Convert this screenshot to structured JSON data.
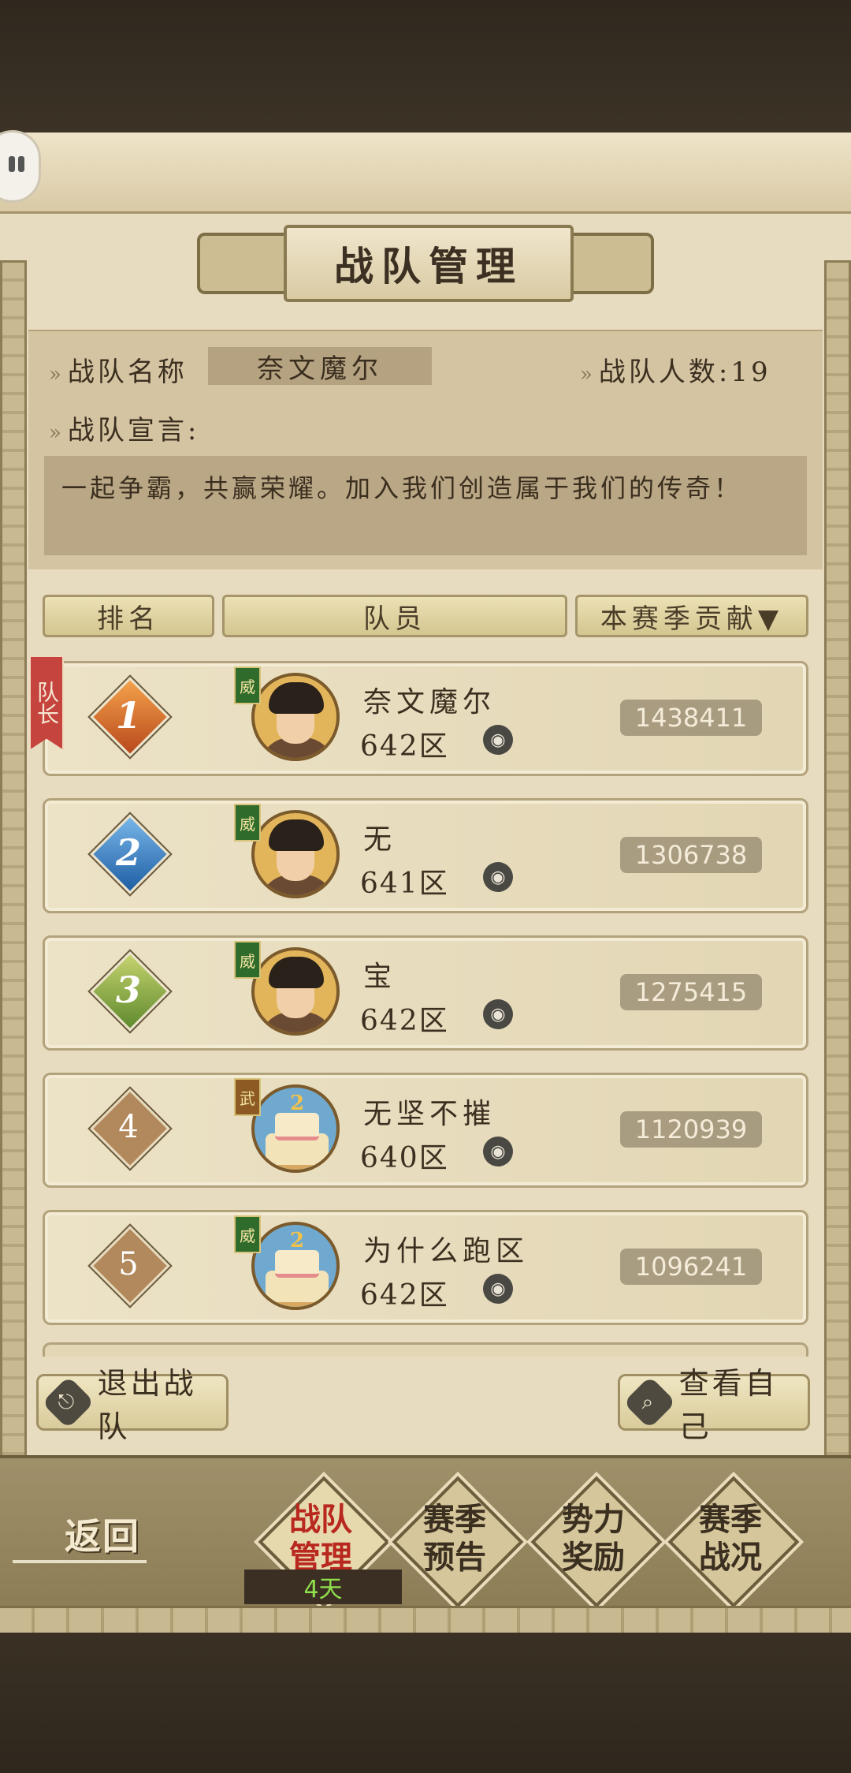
{
  "title": "战队管理",
  "team": {
    "name_label": "战队名称",
    "name": "奈文魔尔",
    "count_label": "战队人数:19",
    "declaration_label": "战队宣言:",
    "declaration": "一起争霸，共赢荣耀。加入我们创造属于我们的传奇！"
  },
  "table": {
    "col_rank": "排名",
    "col_member": "队员",
    "col_contribution": "本赛季贡献▼"
  },
  "captain_label": "队长",
  "members": [
    {
      "rank": "1",
      "name": "奈文魔尔",
      "zone": "642区",
      "score": "1438411",
      "badge": "威",
      "avatar": "scholar"
    },
    {
      "rank": "2",
      "name": "无",
      "zone": "641区",
      "score": "1306738",
      "badge": "威",
      "avatar": "official"
    },
    {
      "rank": "3",
      "name": "宝",
      "zone": "642区",
      "score": "1275415",
      "badge": "威",
      "avatar": "official"
    },
    {
      "rank": "4",
      "name": "无坚不摧",
      "zone": "640区",
      "score": "1120939",
      "badge": "武",
      "avatar": "cake"
    },
    {
      "rank": "5",
      "name": "为什么跑区",
      "zone": "642区",
      "score": "1096241",
      "badge": "威",
      "avatar": "cake"
    }
  ],
  "actions": {
    "leave": "退出战队",
    "view_self": "查看自己"
  },
  "nav": {
    "back": "返回",
    "tabs": [
      {
        "label": "战队\n管理",
        "active": true
      },
      {
        "label": "赛季\n预告",
        "active": false
      },
      {
        "label": "势力\n奖励",
        "active": false
      },
      {
        "label": "赛季\n战况",
        "active": false
      }
    ],
    "timer": "4天"
  },
  "colors": {
    "parchment": "#e8dcc0",
    "active_tab_text": "#b8281f",
    "captain_ribbon": "#c6443e",
    "timer_text": "#8fe04d"
  }
}
